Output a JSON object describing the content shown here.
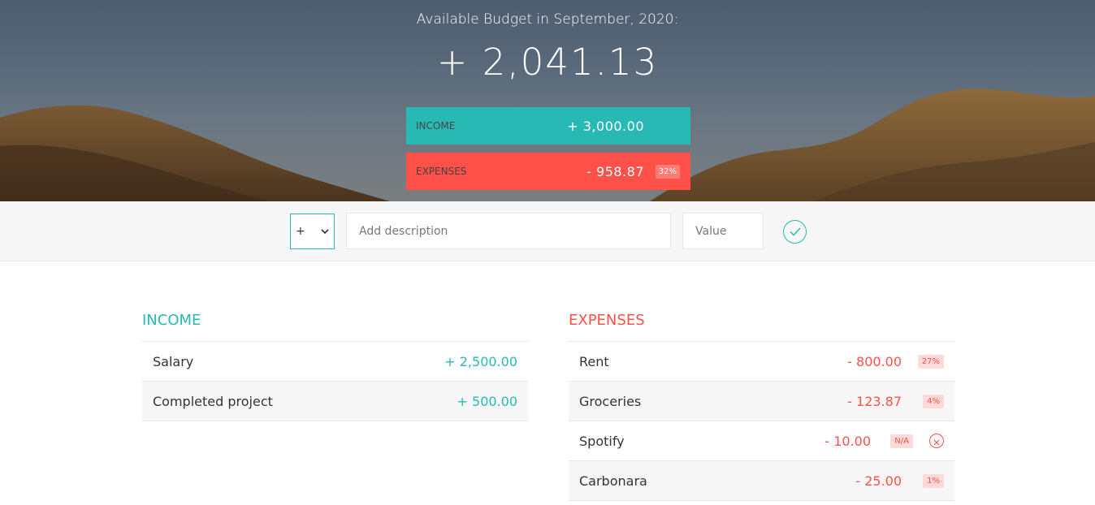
{
  "header": {
    "title": "Available Budget in September, 2020:",
    "budget": "+ 2,041.13",
    "income": {
      "label": "Income",
      "value": "+ 3,000.00"
    },
    "expenses": {
      "label": "Expenses",
      "value": "- 958.87",
      "percentage": "32%"
    }
  },
  "add_bar": {
    "type_selected": "+",
    "description_placeholder": "Add description",
    "value_placeholder": "Value"
  },
  "income": {
    "title": "Income",
    "items": [
      {
        "description": "Salary",
        "value": "+ 2,500.00"
      },
      {
        "description": "Completed project",
        "value": "+ 500.00"
      }
    ]
  },
  "expenses": {
    "title": "Expenses",
    "items": [
      {
        "description": "Rent",
        "value": "- 800.00",
        "percentage": "27%"
      },
      {
        "description": "Groceries",
        "value": "- 123.87",
        "percentage": "4%"
      },
      {
        "description": "Spotify",
        "value": "- 10.00",
        "percentage": "N/A"
      },
      {
        "description": "Carbonara",
        "value": "- 25.00",
        "percentage": "1%"
      }
    ]
  },
  "colors": {
    "income": "#28b9b5",
    "expenses": "#ff5049"
  }
}
